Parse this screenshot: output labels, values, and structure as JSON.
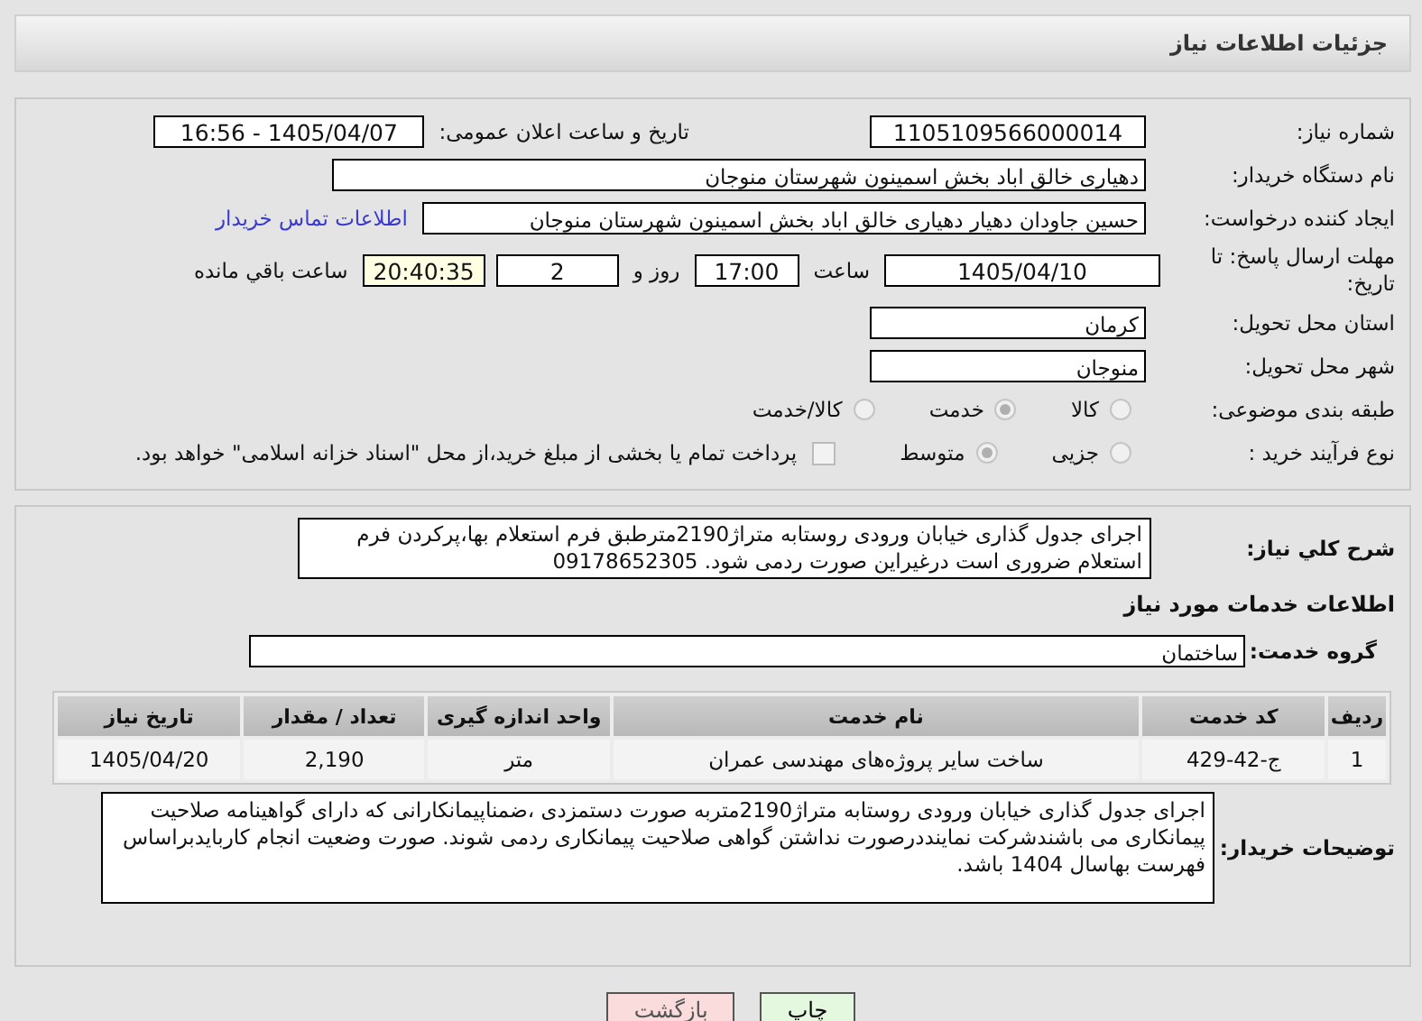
{
  "header": {
    "title": "جزئیات اطلاعات نیاز"
  },
  "need_number": {
    "label": "شماره نیاز:",
    "value": "1105109566000014"
  },
  "announce": {
    "label": "تاریخ و ساعت اعلان عمومی:",
    "value": "1405/04/07 - 16:56"
  },
  "buyer_org": {
    "label": "نام دستگاه خریدار:",
    "value": "دهیاری خالق اباد بخش اسمینون شهرستان منوجان"
  },
  "requester": {
    "label": "ایجاد کننده درخواست:",
    "value": "حسین جاودان دهیار  دهیاری خالق اباد بخش اسمینون شهرستان منوجان",
    "link": "اطلاعات تماس خریدار"
  },
  "deadline": {
    "label": "مهلت ارسال پاسخ: تا تاریخ:",
    "date": "1405/04/10",
    "time_label": "ساعت",
    "time": "17:00",
    "days": "2",
    "days_label": "روز و",
    "remaining": "20:40:35",
    "remaining_label": "ساعت باقي مانده"
  },
  "province": {
    "label": "استان محل تحویل:",
    "value": "کرمان"
  },
  "city": {
    "label": "شهر محل تحویل:",
    "value": "منوجان"
  },
  "category": {
    "label": "طبقه بندی موضوعی:",
    "options": [
      {
        "label": "کالا",
        "selected": false
      },
      {
        "label": "خدمت",
        "selected": true
      },
      {
        "label": "کالا/خدمت",
        "selected": false
      }
    ]
  },
  "process": {
    "label": "نوع فرآیند خرید :",
    "options": [
      {
        "label": "جزیی",
        "selected": false
      },
      {
        "label": "متوسط",
        "selected": true
      }
    ],
    "checkbox": {
      "label": "پرداخت تمام یا بخشی از مبلغ خرید،از محل \"اسناد خزانه اسلامی\" خواهد بود.",
      "checked": false
    }
  },
  "description": {
    "label": "شرح کلي نیاز:",
    "value": "اجرای جدول گذاری خیابان ورودی روستابه متراژ2190مترطبق فرم استعلام بها،پرکردن فرم استعلام ضروری است درغیراین صورت ردمی شود. 09178652305"
  },
  "services_title": "اطلاعات خدمات مورد نیاز",
  "service_group": {
    "label": "گروه خدمت:",
    "value": "ساختمان"
  },
  "table": {
    "columns": [
      "ردیف",
      "کد خدمت",
      "نام خدمت",
      "واحد اندازه گیری",
      "تعداد / مقدار",
      "تاریخ نیاز"
    ],
    "rows": [
      [
        "1",
        "ج-42-429",
        "ساخت سایر پروژه‌های مهندسی عمران",
        "متر",
        "2,190",
        "1405/04/20"
      ]
    ]
  },
  "buyer_notes": {
    "label": "توضیحات خریدار:",
    "value": "اجرای جدول گذاری خیابان ورودی روستابه متراژ2190متربه صورت دستمزدی ،ضمناپیمانکارانی که دارای گواهینامه صلاحیت پیمانکاری می باشندشرکت نمایندد‌رصورت نداشتن گواهی صلاحیت پیمانکاری ردمی شوند. صورت وضعیت انجام کاربایدبراساس فهرست بهاسال 1404 باشد."
  },
  "buttons": [
    {
      "label": "چاپ",
      "kind": "print"
    },
    {
      "label": "بازگشت",
      "kind": "back"
    }
  ]
}
